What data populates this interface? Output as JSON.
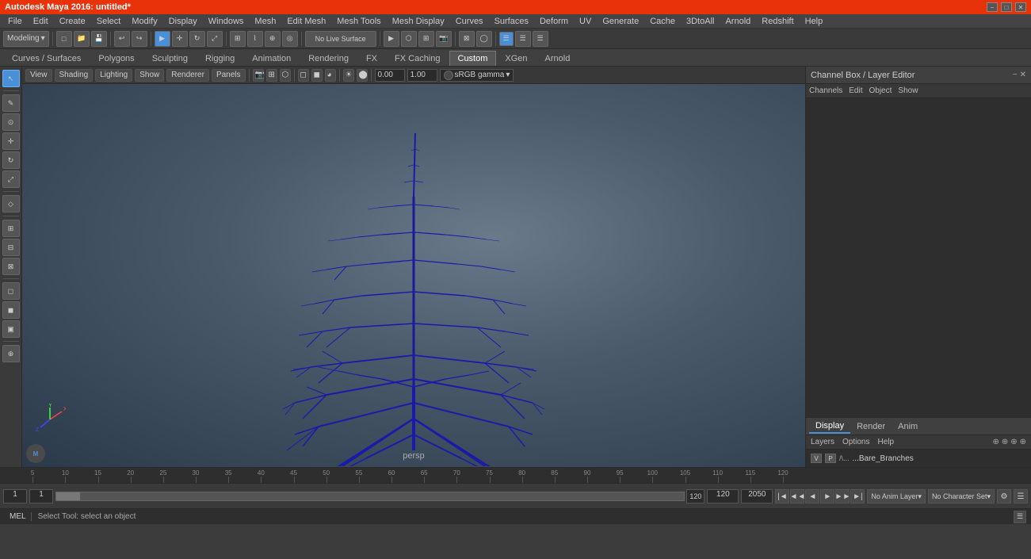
{
  "titleBar": {
    "title": "Autodesk Maya 2016: untitled*",
    "minimizeBtn": "−",
    "maximizeBtn": "□",
    "closeBtn": "✕"
  },
  "menuBar": {
    "items": [
      "File",
      "Edit",
      "Create",
      "Select",
      "Modify",
      "Display",
      "Windows",
      "Mesh",
      "Edit Mesh",
      "Mesh Tools",
      "Mesh Display",
      "Curves",
      "Surfaces",
      "Deform",
      "UV",
      "Generate",
      "Cache",
      "3DtoAll",
      "Arnold",
      "Redshift",
      "Help"
    ]
  },
  "toolbarLeft": {
    "dropdown": "Modeling"
  },
  "tabs": {
    "items": [
      "Curves / Surfaces",
      "Polygons",
      "Sculpting",
      "Rigging",
      "Animation",
      "Rendering",
      "FX",
      "FX Caching",
      "Custom",
      "XGen",
      "Arnold"
    ],
    "active": "Custom"
  },
  "viewport": {
    "label": "persp",
    "viewMenu": "View",
    "shadingMenu": "Shading",
    "lightingMenu": "Lighting",
    "showMenu": "Show",
    "rendererMenu": "Renderer",
    "panelsMenu": "Panels",
    "gammaLabel": "sRGB gamma",
    "valueA": "0.00",
    "valueB": "1.00"
  },
  "rightPanel": {
    "title": "Channel Box / Layer Editor",
    "channelsLabel": "Channels",
    "editLabel": "Edit",
    "objectLabel": "Object",
    "showLabel": "Show"
  },
  "displayTabs": {
    "tabs": [
      "Display",
      "Render",
      "Anim"
    ],
    "active": "Display",
    "subtabs": [
      "Layers",
      "Options",
      "Help"
    ]
  },
  "layer": {
    "vLabel": "V",
    "pLabel": "P",
    "name": "...Bare_Branches"
  },
  "timeline": {
    "startFrame": "1",
    "currentFrame": "1",
    "endFrame": "120",
    "rangeEnd": "120",
    "animEnd": "2050",
    "noAnimLayer": "No Anim Layer",
    "noCharSet": "No Character Set"
  },
  "statusBar": {
    "melLabel": "MEL",
    "statusText": "Select Tool: select an object"
  },
  "ruler": {
    "ticks": [
      0,
      45,
      90,
      135,
      180,
      225,
      270,
      315,
      360,
      405,
      450,
      495,
      540,
      585,
      630,
      675,
      720,
      765,
      810,
      855,
      900,
      945,
      990
    ],
    "labels": [
      {
        "val": "5",
        "pos": 45
      },
      {
        "val": "10",
        "pos": 90
      },
      {
        "val": "15",
        "pos": 135
      },
      {
        "val": "20",
        "pos": 180
      },
      {
        "val": "25",
        "pos": 225
      },
      {
        "val": "30",
        "pos": 270
      },
      {
        "val": "35",
        "pos": 315
      },
      {
        "val": "40",
        "pos": 360
      },
      {
        "val": "45",
        "pos": 405
      },
      {
        "val": "50",
        "pos": 450
      },
      {
        "val": "55",
        "pos": 495
      },
      {
        "val": "60",
        "pos": 540
      },
      {
        "val": "65",
        "pos": 585
      },
      {
        "val": "70",
        "pos": 630
      },
      {
        "val": "75",
        "pos": 675
      },
      {
        "val": "80",
        "pos": 720
      },
      {
        "val": "85",
        "pos": 765
      },
      {
        "val": "90",
        "pos": 810
      },
      {
        "val": "95",
        "pos": 855
      },
      {
        "val": "100",
        "pos": 900
      },
      {
        "val": "105",
        "pos": 945
      },
      {
        "val": "110",
        "pos": 990
      },
      {
        "val": "115",
        "pos": 1035
      },
      {
        "val": "120",
        "pos": 1080
      }
    ]
  }
}
